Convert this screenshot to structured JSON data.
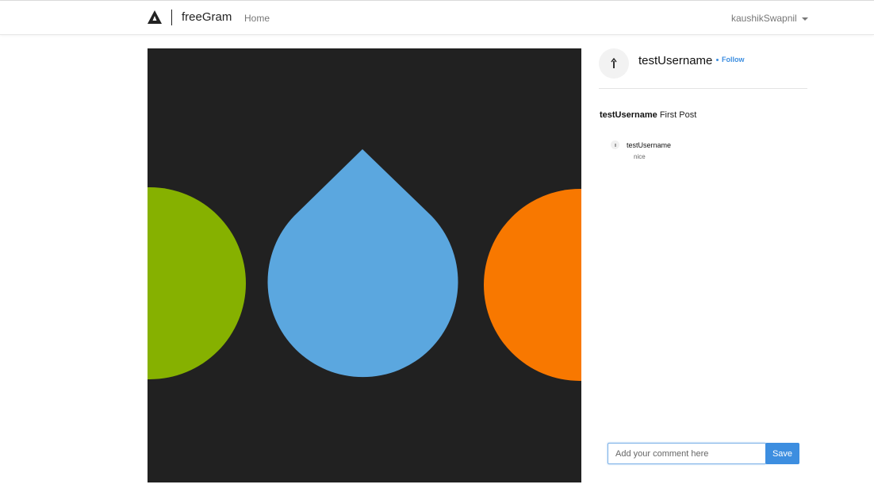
{
  "navbar": {
    "brand_name": "freeGram",
    "home_label": "Home",
    "user_label": "kaushikSwapnil"
  },
  "post": {
    "image_colors": {
      "background": "#212121",
      "left_circle": "#86b100",
      "drop": "#5ba7df",
      "right_circle": "#f87800"
    },
    "author": {
      "username": "testUsername",
      "follow_label": "Follow"
    },
    "caption": {
      "username": "testUsername",
      "text": "First Post"
    },
    "comments": [
      {
        "username": "testUsername",
        "text": "nice"
      }
    ]
  },
  "comment_form": {
    "placeholder": "Add your comment here",
    "save_label": "Save"
  },
  "colors": {
    "accent": "#3d8ee0"
  }
}
